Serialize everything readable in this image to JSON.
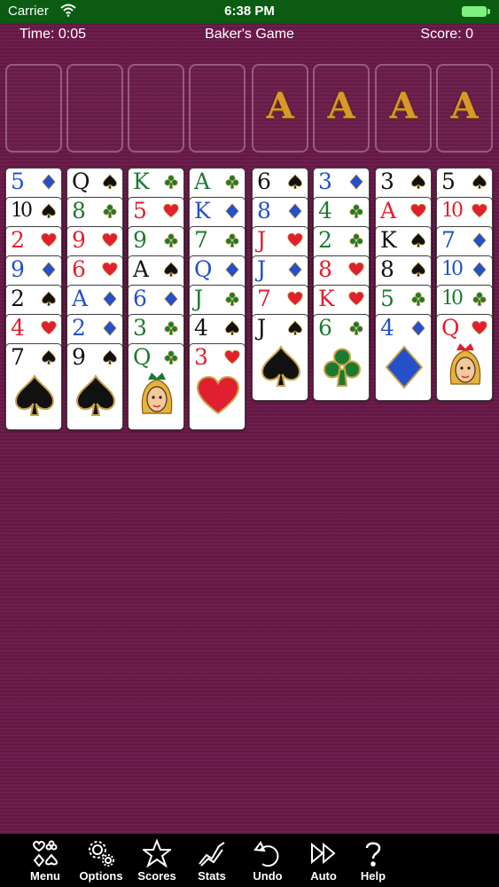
{
  "status_bar": {
    "carrier": "Carrier",
    "time": "6:38 PM"
  },
  "header": {
    "time": "Time: 0:05",
    "title": "Baker's Game",
    "score": "Score: 0"
  },
  "free_cells": 4,
  "foundations": [
    {
      "rank": "A"
    },
    {
      "rank": "A"
    },
    {
      "rank": "A"
    },
    {
      "rank": "A"
    }
  ],
  "colors": {
    "felt": "#6b1a49",
    "status_bar": "#0b5c12",
    "hearts": "#e0202e",
    "spades": "#111111",
    "diamonds": "#2450c8",
    "clubs": "#1b7a2e"
  },
  "columns": [
    [
      {
        "rank": "5",
        "suit": "diamonds"
      },
      {
        "rank": "10",
        "suit": "spades"
      },
      {
        "rank": "2",
        "suit": "hearts"
      },
      {
        "rank": "9",
        "suit": "diamonds"
      },
      {
        "rank": "2",
        "suit": "spades"
      },
      {
        "rank": "4",
        "suit": "hearts"
      },
      {
        "rank": "7",
        "suit": "spades"
      }
    ],
    [
      {
        "rank": "Q",
        "suit": "spades"
      },
      {
        "rank": "8",
        "suit": "clubs"
      },
      {
        "rank": "9",
        "suit": "hearts"
      },
      {
        "rank": "6",
        "suit": "hearts"
      },
      {
        "rank": "A",
        "suit": "diamonds"
      },
      {
        "rank": "2",
        "suit": "diamonds"
      },
      {
        "rank": "9",
        "suit": "spades"
      }
    ],
    [
      {
        "rank": "K",
        "suit": "clubs"
      },
      {
        "rank": "5",
        "suit": "hearts"
      },
      {
        "rank": "9",
        "suit": "clubs"
      },
      {
        "rank": "A",
        "suit": "spades"
      },
      {
        "rank": "6",
        "suit": "diamonds"
      },
      {
        "rank": "3",
        "suit": "clubs"
      },
      {
        "rank": "Q",
        "suit": "clubs"
      }
    ],
    [
      {
        "rank": "A",
        "suit": "clubs"
      },
      {
        "rank": "K",
        "suit": "diamonds"
      },
      {
        "rank": "7",
        "suit": "clubs"
      },
      {
        "rank": "Q",
        "suit": "diamonds"
      },
      {
        "rank": "J",
        "suit": "clubs"
      },
      {
        "rank": "4",
        "suit": "spades"
      },
      {
        "rank": "3",
        "suit": "hearts"
      }
    ],
    [
      {
        "rank": "6",
        "suit": "spades"
      },
      {
        "rank": "8",
        "suit": "diamonds"
      },
      {
        "rank": "J",
        "suit": "hearts"
      },
      {
        "rank": "J",
        "suit": "diamonds"
      },
      {
        "rank": "7",
        "suit": "hearts"
      },
      {
        "rank": "J",
        "suit": "spades"
      }
    ],
    [
      {
        "rank": "3",
        "suit": "diamonds"
      },
      {
        "rank": "4",
        "suit": "clubs"
      },
      {
        "rank": "2",
        "suit": "clubs"
      },
      {
        "rank": "8",
        "suit": "hearts"
      },
      {
        "rank": "K",
        "suit": "hearts"
      },
      {
        "rank": "6",
        "suit": "clubs"
      }
    ],
    [
      {
        "rank": "3",
        "suit": "spades"
      },
      {
        "rank": "A",
        "suit": "hearts"
      },
      {
        "rank": "K",
        "suit": "spades"
      },
      {
        "rank": "8",
        "suit": "spades"
      },
      {
        "rank": "5",
        "suit": "clubs"
      },
      {
        "rank": "4",
        "suit": "diamonds"
      }
    ],
    [
      {
        "rank": "5",
        "suit": "spades"
      },
      {
        "rank": "10",
        "suit": "hearts"
      },
      {
        "rank": "7",
        "suit": "diamonds"
      },
      {
        "rank": "10",
        "suit": "diamonds"
      },
      {
        "rank": "10",
        "suit": "clubs"
      },
      {
        "rank": "Q",
        "suit": "hearts"
      }
    ]
  ],
  "toolbar": [
    {
      "label": "Menu",
      "icon": "menu-suits-icon"
    },
    {
      "label": "Options",
      "icon": "gears-icon"
    },
    {
      "label": "Scores",
      "icon": "star-icon"
    },
    {
      "label": "Stats",
      "icon": "chart-icon"
    },
    {
      "label": "Undo",
      "icon": "undo-icon"
    },
    {
      "label": "Auto",
      "icon": "fast-forward-icon"
    },
    {
      "label": "Help",
      "icon": "question-icon"
    }
  ]
}
